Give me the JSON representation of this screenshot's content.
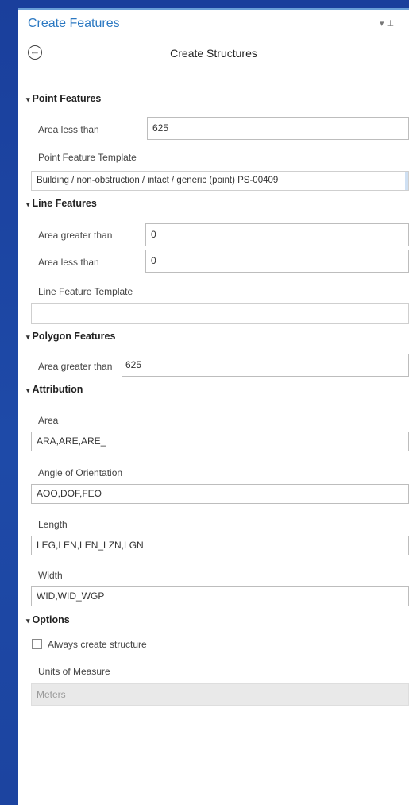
{
  "pane": {
    "title": "Create Features",
    "pin_glyph": "▾ %",
    "heading": "Create Structures",
    "back_icon": "back-arrow-circle-icon"
  },
  "point_features": {
    "header": "Point Features",
    "area_less_than_label": "Area less than",
    "area_less_than_value": "625",
    "template_label": "Point Feature Template",
    "template_value": "Building / non-obstruction / intact / generic (point) PS-00409"
  },
  "line_features": {
    "header": "Line Features",
    "area_greater_than_label": "Area greater than",
    "area_greater_than_value": "0",
    "area_less_than_label": "Area less than",
    "area_less_than_value": "0",
    "template_label": "Line Feature Template",
    "template_value": ""
  },
  "polygon_features": {
    "header": "Polygon Features",
    "area_greater_than_label": "Area greater than",
    "area_greater_than_value": "625"
  },
  "attribution": {
    "header": "Attribution",
    "area_label": "Area",
    "area_value": "ARA,ARE,ARE_",
    "angle_label": "Angle of Orientation",
    "angle_value": "AOO,DOF,FEO",
    "length_label": "Length",
    "length_value": "LEG,LEN,LEN_LZN,LGN",
    "width_label": "Width",
    "width_value": "WID,WID_WGP"
  },
  "options": {
    "header": "Options",
    "always_create_label": "Always create structure",
    "always_create_checked": false,
    "units_label": "Units of Measure",
    "units_value": "Meters"
  },
  "colors": {
    "title_blue": "#2b78c2",
    "background_blue": "#1d45a6"
  }
}
